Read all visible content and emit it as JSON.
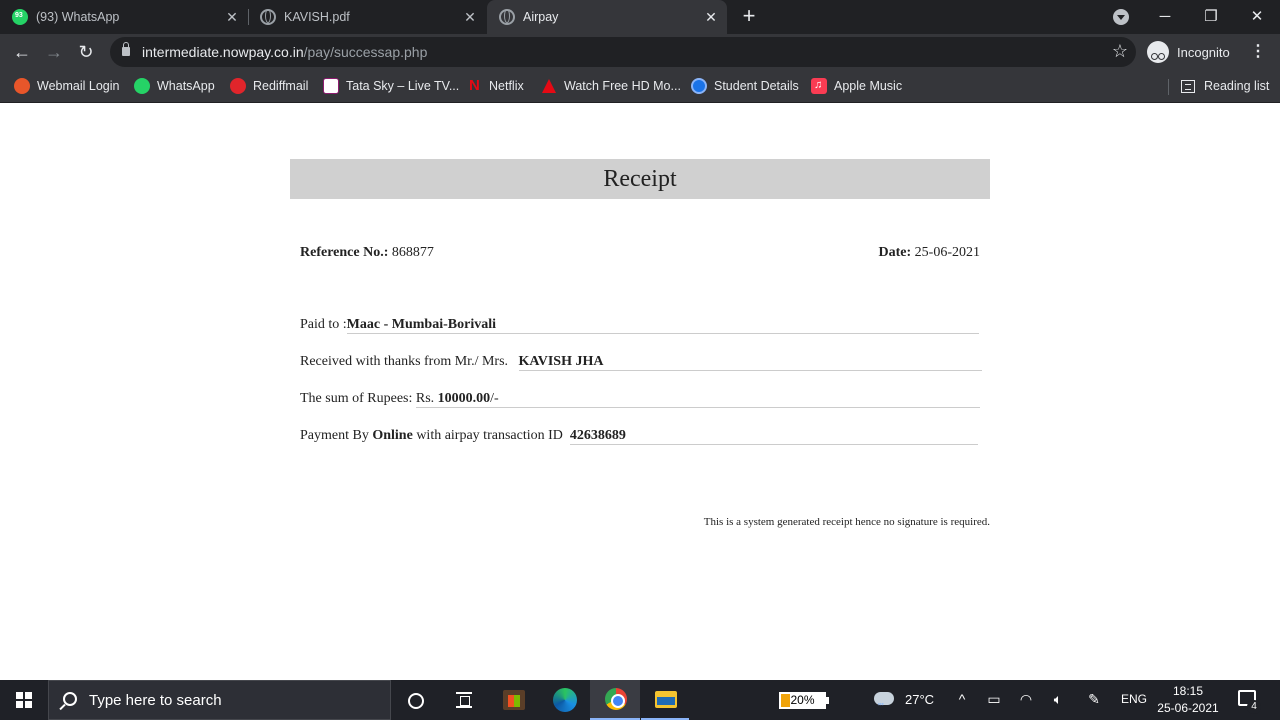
{
  "browser": {
    "tabs": [
      {
        "title": "(93) WhatsApp",
        "active": false
      },
      {
        "title": "KAVISH.pdf",
        "active": false
      },
      {
        "title": "Airpay",
        "active": true
      }
    ],
    "url_host": "intermediate.nowpay.co.in",
    "url_path": "/pay/successap.php",
    "profile_label": "Incognito",
    "bookmarks": [
      {
        "label": "Webmail Login",
        "icon": "webmail-icon"
      },
      {
        "label": "WhatsApp",
        "icon": "whatsapp-icon"
      },
      {
        "label": "Rediffmail",
        "icon": "rediffmail-icon"
      },
      {
        "label": "Tata Sky – Live TV...",
        "icon": "tatasky-icon"
      },
      {
        "label": "Netflix",
        "icon": "netflix-icon"
      },
      {
        "label": "Watch Free HD Mo...",
        "icon": "watch-icon"
      },
      {
        "label": "Student Details",
        "icon": "student-icon"
      },
      {
        "label": "Apple Music",
        "icon": "music-icon"
      }
    ],
    "reading_list": "Reading list"
  },
  "receipt": {
    "title": "Receipt",
    "reference_label": "Reference No.:",
    "reference_value": "868877",
    "date_label": "Date:",
    "date_value": "25-06-2021",
    "paid_to_label": "Paid to :",
    "paid_to_value": "Maac - Mumbai-Borivali",
    "received_label": "Received with thanks from Mr./ Mrs.",
    "received_value": "KAVISH JHA",
    "sum_label": "The sum of Rupees:",
    "sum_prefix": "Rs.",
    "sum_value": "10000.00",
    "sum_suffix": "/-",
    "payment_label_1": "Payment By",
    "payment_method": "Online",
    "payment_label_2": "with airpay transaction ID",
    "transaction_id": "42638689",
    "footer_note": "This is a system generated receipt hence no signature is required."
  },
  "taskbar": {
    "search_placeholder": "Type here to search",
    "battery_percent": "20%",
    "battery_level": 0.2,
    "weather": "27°C",
    "language": "ENG",
    "time": "18:15",
    "date": "25-06-2021",
    "notification_count": "4"
  },
  "colors": {
    "chrome_dark": "#202124",
    "chrome_toolbar": "#35363a",
    "receipt_header_bg": "#d0d0d0",
    "taskbar_bg": "#1f2127"
  }
}
